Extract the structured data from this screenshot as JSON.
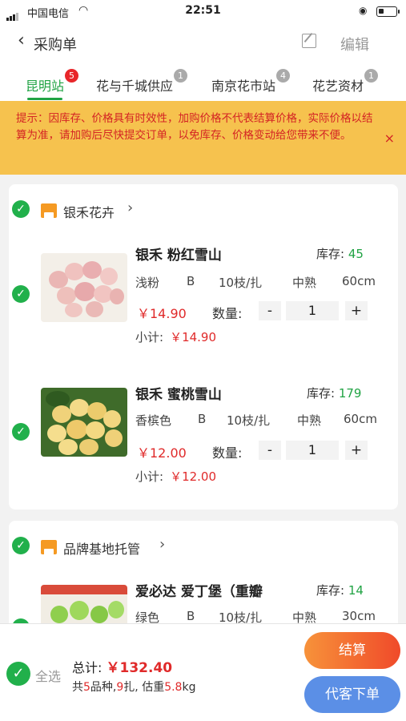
{
  "status_bar": {
    "carrier": "中国电信",
    "time": "22:51"
  },
  "nav": {
    "title": "采购单",
    "edit_label": "编辑"
  },
  "tabs": [
    {
      "label": "昆明站",
      "badge": "5",
      "active": true
    },
    {
      "label": "花与千城供应",
      "badge": "1"
    },
    {
      "label": "南京花市站",
      "badge": "4"
    },
    {
      "label": "花艺资材",
      "badge": "1"
    }
  ],
  "notice": {
    "text": "提示：因库存、价格具有时效性，加购价格不代表结算价格，实际价格以结算为准，请加购后尽快提交订单，以免库存、价格变动给您带来不便。",
    "close": "×"
  },
  "shops": [
    {
      "name": "银禾花卉",
      "products": [
        {
          "name": "银禾 粉红雪山",
          "stock_label": "库存:",
          "stock": "45",
          "color": "浅粉",
          "grade": "B",
          "bundle": "10枝/扎",
          "maturity": "中熟",
          "length": "60cm",
          "price": "￥14.90",
          "qty_label": "数量:",
          "qty": "1",
          "subtotal_label": "小计:",
          "subtotal": "￥14.90"
        },
        {
          "name": "银禾 蜜桃雪山",
          "stock_label": "库存:",
          "stock": "179",
          "color": "香槟色",
          "grade": "B",
          "bundle": "10枝/扎",
          "maturity": "中熟",
          "length": "60cm",
          "price": "￥12.00",
          "qty_label": "数量:",
          "qty": "1",
          "subtotal_label": "小计:",
          "subtotal": "￥12.00"
        }
      ]
    },
    {
      "name": "品牌基地托管",
      "products": [
        {
          "name": "爱必达 爱丁堡（重瓣",
          "stock_label": "库存:",
          "stock": "14",
          "color": "绿色",
          "grade": "B",
          "bundle": "10枝/扎",
          "maturity": "中熟",
          "length": "30cm"
        }
      ]
    }
  ],
  "qty_minus": "-",
  "qty_plus": "+",
  "bottom": {
    "select_all": "全选",
    "total_label": "总计:",
    "total": "￥132.40",
    "summary_prefix": "共",
    "kinds": "5",
    "summary_mid1": "品种,",
    "bundles": "9",
    "summary_mid2": "扎, 估重",
    "weight": "5.8",
    "summary_suffix": "kg",
    "settle_label": "结算",
    "proxy_label": "代客下单"
  },
  "colors": {
    "green": "#21a344",
    "red": "#e02a2a",
    "notice_bg": "#f6c24e",
    "settle": "#f04a2a",
    "proxy": "#5b8fe6"
  }
}
